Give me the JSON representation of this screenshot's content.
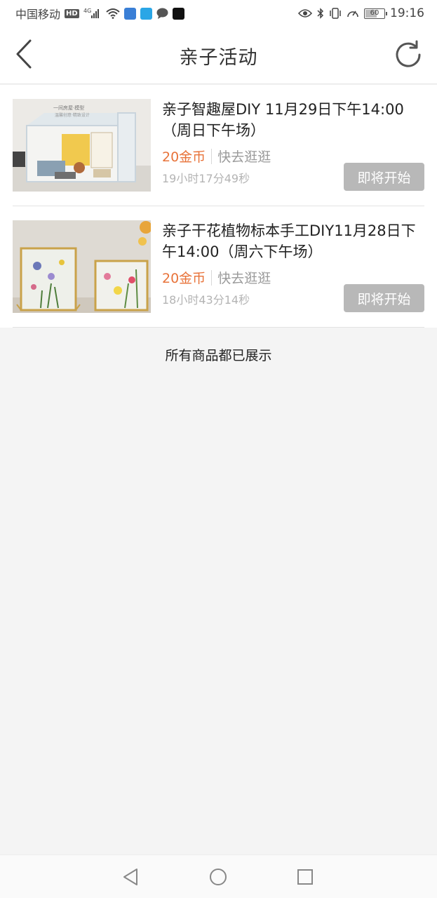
{
  "status_bar": {
    "carrier": "中国移动",
    "hd": "HD",
    "network": "4G",
    "battery": "60",
    "time": "19:16"
  },
  "header": {
    "title": "亲子活动",
    "back_icon": "chevron-left-icon",
    "refresh_icon": "refresh-icon"
  },
  "activities": [
    {
      "title": "亲子智趣屋DIY 11月29日下午14:00（周日下午场）",
      "price": "20金币",
      "link": "快去逛逛",
      "countdown": "19小时17分49秒",
      "button": "即将开始",
      "image_caption": "一间房屋·模型",
      "image_subcaption": "温馨创意·精致设计"
    },
    {
      "title": "亲子干花植物标本手工DIY11月28日下午14:00（周六下午场）",
      "price": "20金币",
      "link": "快去逛逛",
      "countdown": "18小时43分14秒",
      "button": "即将开始"
    }
  ],
  "footer_note": "所有商品都已展示",
  "colors": {
    "price": "#e8733a",
    "button_disabled": "#b8b8b8",
    "page_bg": "#f4f4f4"
  },
  "nav": {
    "back": "triangle-back-icon",
    "home": "circle-home-icon",
    "recent": "square-recent-icon"
  }
}
